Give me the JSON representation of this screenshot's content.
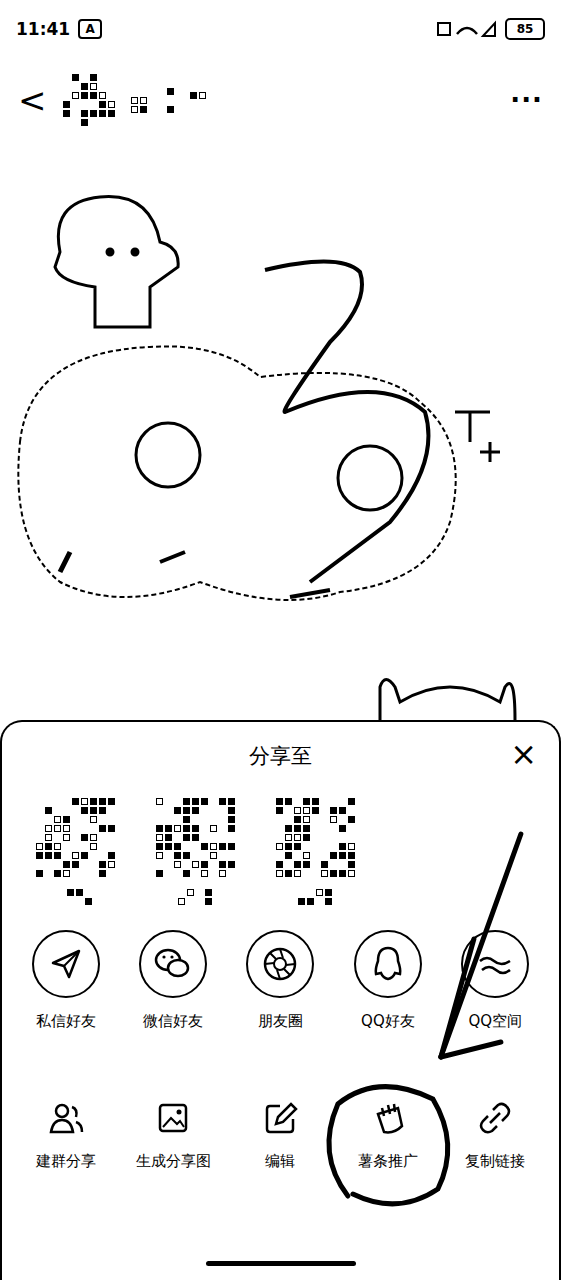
{
  "status_bar": {
    "time": "11:41",
    "badge": "A",
    "battery": "85"
  },
  "header": {
    "back": "<",
    "more": "···",
    "author_obscured": true
  },
  "share_sheet": {
    "title": "分享至",
    "close": "×",
    "contacts": [
      {
        "obscured": true
      },
      {
        "obscured": true
      },
      {
        "obscured": true
      }
    ],
    "primary": [
      {
        "label": "私信好友"
      },
      {
        "label": "微信好友"
      },
      {
        "label": "朋友圈"
      },
      {
        "label": "QQ好友"
      },
      {
        "label": "QQ空间"
      }
    ],
    "secondary": [
      {
        "label": "建群分享",
        "circled": false
      },
      {
        "label": "生成分享图",
        "circled": false
      },
      {
        "label": "编辑",
        "circled": false
      },
      {
        "label": "薯条推广",
        "circled": true
      },
      {
        "label": "复制链接",
        "circled": false
      }
    ]
  }
}
